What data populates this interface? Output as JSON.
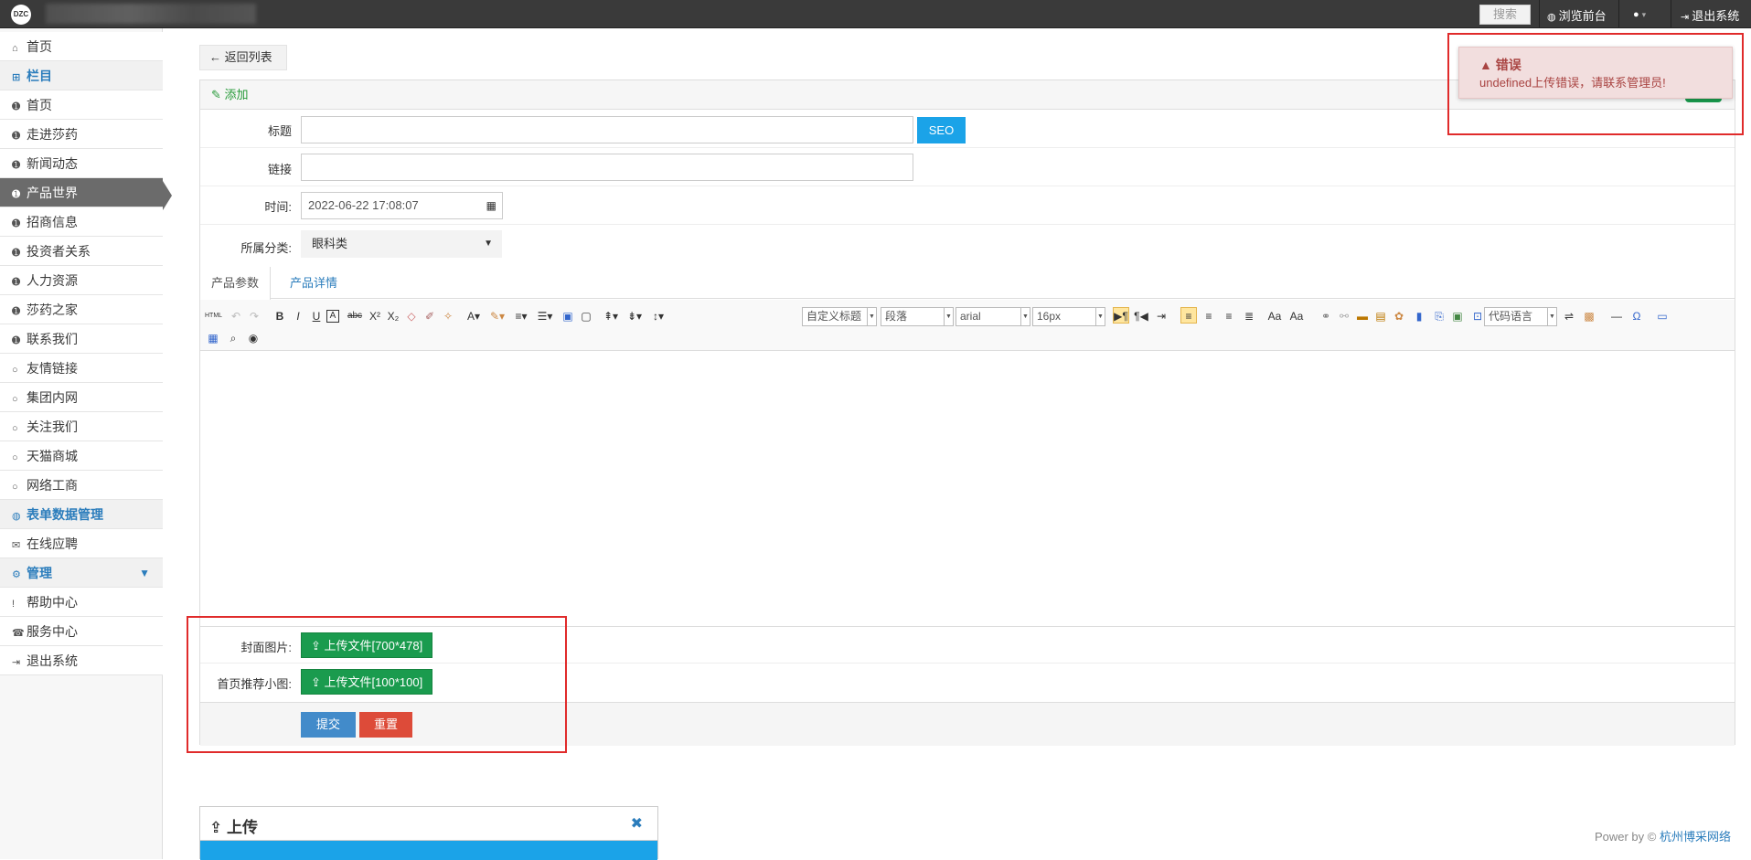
{
  "topbar": {
    "search_placeholder": "搜索",
    "browse_front": "浏览前台",
    "user_caret": "▾",
    "logout": "退出系统"
  },
  "sidebar": {
    "items": [
      {
        "label": "首页",
        "icon": "home-icon"
      },
      {
        "label": "栏目",
        "icon": "sitemap-icon"
      },
      {
        "label": "首页",
        "icon": "circle-arrow-icon"
      },
      {
        "label": "走进莎药",
        "icon": "circle-arrow-icon"
      },
      {
        "label": "新闻动态",
        "icon": "circle-arrow-icon"
      },
      {
        "label": "产品世界",
        "icon": "circle-arrow-icon"
      },
      {
        "label": "招商信息",
        "icon": "circle-arrow-icon"
      },
      {
        "label": "投资者关系",
        "icon": "circle-arrow-icon"
      },
      {
        "label": "人力资源",
        "icon": "circle-arrow-icon"
      },
      {
        "label": "莎药之家",
        "icon": "circle-arrow-icon"
      },
      {
        "label": "联系我们",
        "icon": "circle-arrow-icon"
      },
      {
        "label": "友情链接",
        "icon": "circle-outline-icon"
      },
      {
        "label": "集团内网",
        "icon": "circle-outline-icon"
      },
      {
        "label": "关注我们",
        "icon": "circle-outline-icon"
      },
      {
        "label": "天猫商城",
        "icon": "circle-outline-icon"
      },
      {
        "label": "网络工商",
        "icon": "circle-outline-icon"
      },
      {
        "label": "表单数据管理",
        "icon": "globe-icon"
      },
      {
        "label": "在线应聘",
        "icon": "comments-icon"
      },
      {
        "label": "管理",
        "icon": "cogs-icon"
      },
      {
        "label": "帮助中心",
        "icon": "help-icon"
      },
      {
        "label": "服务中心",
        "icon": "phone-icon"
      },
      {
        "label": "退出系统",
        "icon": "sign-out-icon"
      }
    ]
  },
  "back_button": "返回列表",
  "panel": {
    "title": "添加",
    "fields": {
      "title_label": "标题",
      "title_value": "",
      "seo_button": "SEO",
      "link_label": "链接",
      "link_value": "",
      "time_label": "时间:",
      "time_value": "2022-06-22 17:08:07",
      "category_label": "所属分类:",
      "category_value": "眼科类"
    },
    "tabs": [
      "产品参数",
      "产品详情"
    ],
    "toolbar": {
      "heading_select": "自定义标题",
      "paragraph_select": "段落",
      "font_select": "arial",
      "size_select": "16px",
      "code_select": "代码语言"
    },
    "cover_label": "封面图片:",
    "cover_upload": "上传文件[700*478]",
    "thumb_label": "首页推荐小图:",
    "thumb_upload": "上传文件[100*100]",
    "submit": "提交",
    "reset": "重置"
  },
  "toast": {
    "title": "错误",
    "message": "undefined上传错误，请联系管理员!"
  },
  "upload_dialog": {
    "title": "上传"
  },
  "footer": {
    "power_by": "Power by ©",
    "company": "杭州博采网络"
  },
  "colors": {
    "accent_blue": "#2b7dbc",
    "upload_green": "#1a9b4e",
    "seo_blue": "#1ba3e8",
    "submit_blue": "#428bca",
    "reset_red": "#dd4b39",
    "error_bg": "#f2dede",
    "error_text": "#a94442",
    "highlight_red": "#e02b2b"
  }
}
